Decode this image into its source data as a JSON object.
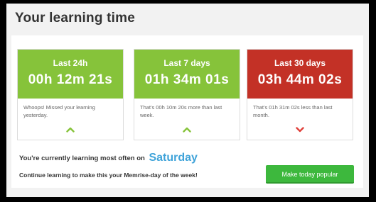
{
  "page": {
    "title": "Your learning time"
  },
  "cards": [
    {
      "period": "Last 24h",
      "value": "00h 12m 21s",
      "note": "Whoops! Missed your learning yesterday.",
      "color": "#86c33a",
      "trend": "up",
      "trend_icon": "chevron-up-icon",
      "trend_color": "#86c33a"
    },
    {
      "period": "Last 7 days",
      "value": "01h 34m 01s",
      "note": "That's 00h 10m 20s more than last week.",
      "color": "#86c33a",
      "trend": "up",
      "trend_icon": "chevron-up-icon",
      "trend_color": "#86c33a"
    },
    {
      "period": "Last 30 days",
      "value": "03h 44m 02s",
      "note": "That's 01h 31m 02s less than last month.",
      "color": "#c33126",
      "trend": "down",
      "trend_icon": "chevron-down-icon",
      "trend_color": "#e0403a"
    }
  ],
  "summary": {
    "prefix": "You're currently learning most often on",
    "day": "Saturday",
    "day_color": "#3fa3d9",
    "cta_text": "Continue learning to make this your Memrise-day of the week!"
  },
  "button": {
    "label": "Make today popular",
    "color": "#3db83d"
  }
}
